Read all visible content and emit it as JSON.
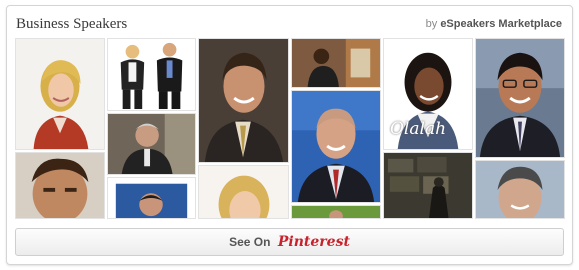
{
  "widget": {
    "title": "Business Speakers",
    "byline_prefix": "by",
    "byline_author": "eSpeakers Marketplace"
  },
  "photos": {
    "olalah_caption": "Olalah"
  },
  "footer": {
    "see_on_prefix": "See On",
    "see_on_brand": "Pinterest"
  },
  "colors": {
    "brand": "#c8232c",
    "border": "#d5d5d5",
    "title_text": "#3a3a3a"
  }
}
